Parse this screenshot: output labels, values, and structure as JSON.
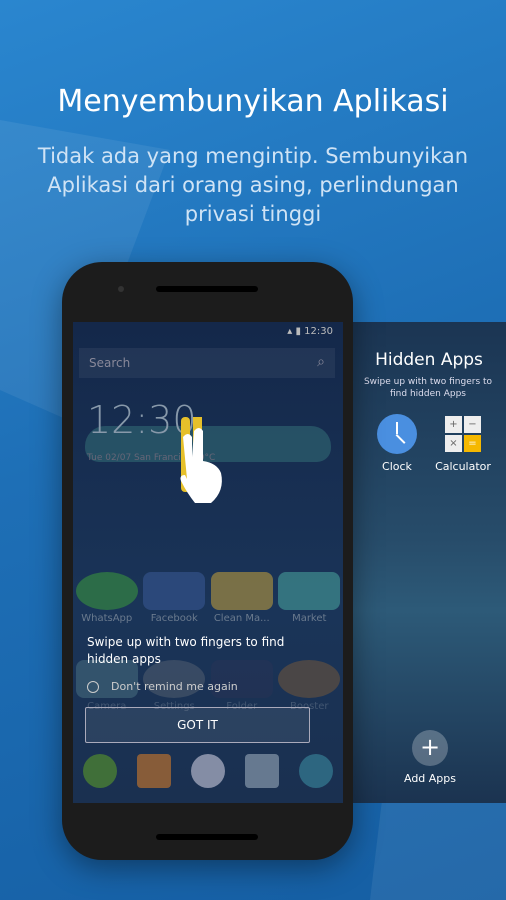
{
  "header": {
    "title": "Menyembunyikan Aplikasi",
    "subtitle": "Tidak ada yang mengintip. Sembunyikan Aplikasi dari orang asing, perlindungan privasi tinggi"
  },
  "hidden_panel": {
    "title": "Hidden Apps",
    "hint": "Swipe up with two fingers to find hidden Apps",
    "apps": [
      {
        "label": "Clock",
        "icon": "clock-icon"
      },
      {
        "label": "Calculator",
        "icon": "calculator-icon"
      }
    ],
    "add_label": "Add Apps"
  },
  "phone": {
    "status_time": "12:30",
    "search_placeholder": "Search",
    "clock": "12:30",
    "date_line": "Tue 02/07 San Francisco 0°C",
    "apps_row1": [
      "WhatsApp",
      "Facebook",
      "Clean Ma...",
      "Market"
    ],
    "apps_row2": [
      "Camera",
      "Settings",
      "Folder",
      "Booster"
    ],
    "dialog": {
      "message": "Swipe up with two fingers to find hidden apps",
      "checkbox": "Don't remind me again",
      "button": "GOT IT"
    }
  },
  "colors": {
    "background": "#1e6fb6",
    "accent": "#f5b800"
  }
}
